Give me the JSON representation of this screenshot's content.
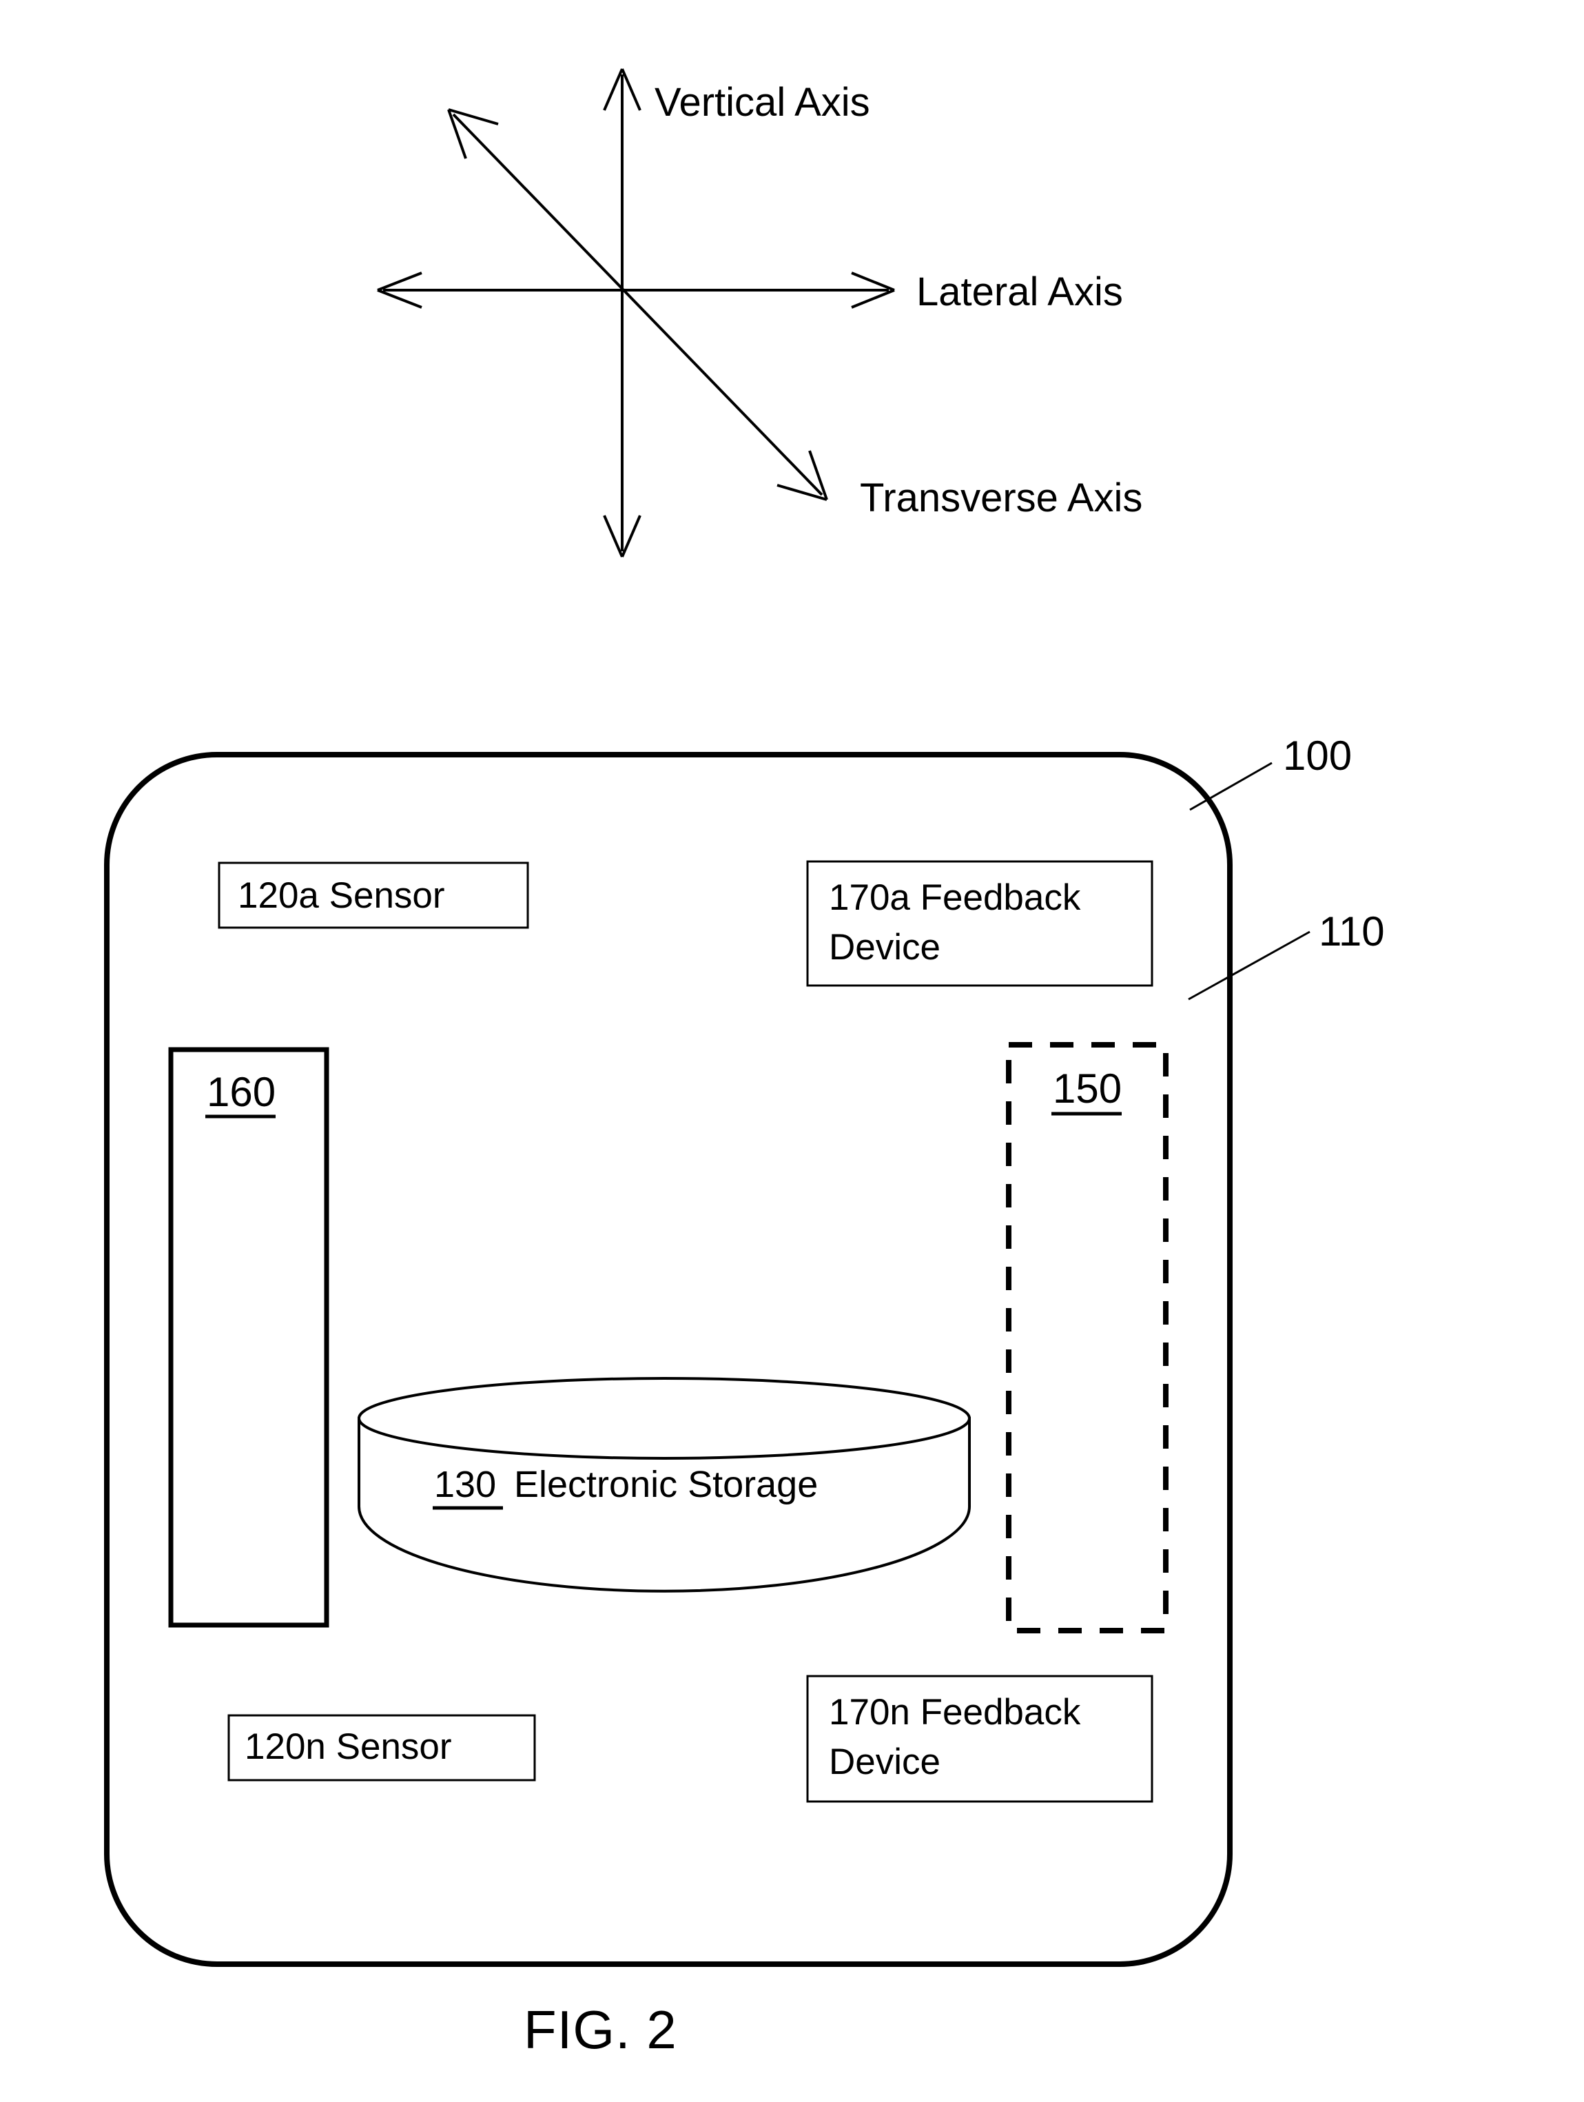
{
  "figure": {
    "caption": "FIG. 2",
    "axes_legend": {
      "vertical_label": "Vertical Axis",
      "lateral_label": "Lateral Axis",
      "transverse_label": "Transverse Axis"
    },
    "device": {
      "outer_ref": "100",
      "shell_ref": "110",
      "components": {
        "sensor_a": "120a Sensor",
        "sensor_n": "120n Sensor",
        "feedback_a_line1": "170a Feedback",
        "feedback_a_line2": "Device",
        "feedback_n_line1": "170n Feedback",
        "feedback_n_line2": "Device",
        "processor_ref": "160",
        "optional_module_ref": "150",
        "storage_ref": "130",
        "storage_name": "Electronic Storage"
      }
    }
  },
  "colors": {
    "ink": "#000000",
    "paper": "#ffffff"
  }
}
